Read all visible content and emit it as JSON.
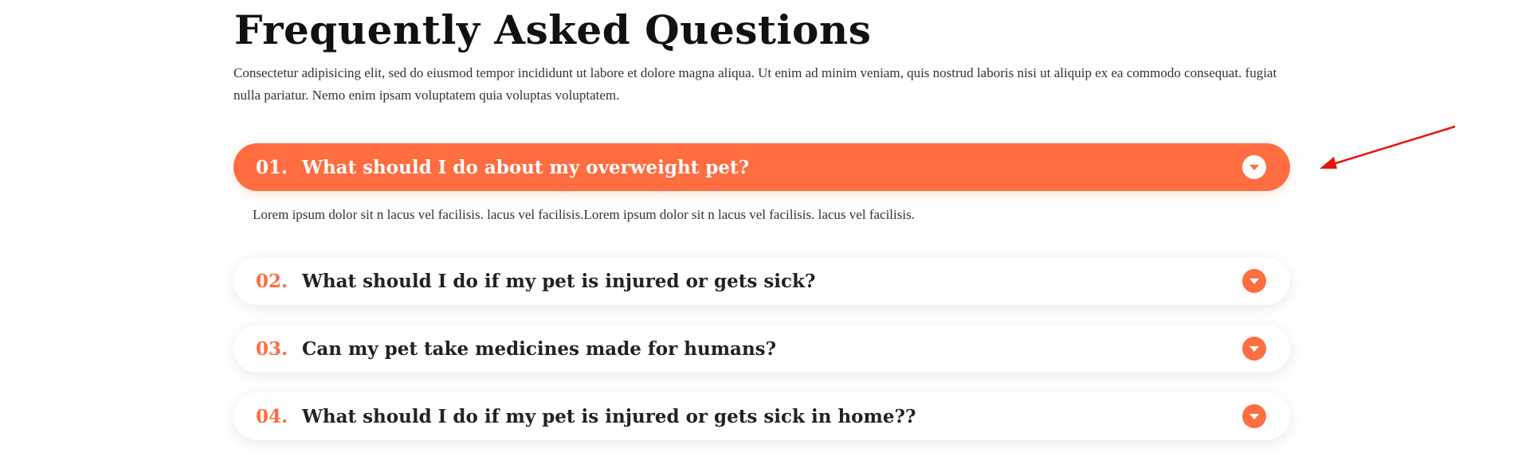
{
  "faq": {
    "title": "Frequently Asked Questions",
    "intro": "Consectetur adipisicing elit, sed do eiusmod tempor incididunt ut labore et dolore magna aliqua. Ut enim ad minim veniam, quis nostrud laboris nisi ut aliquip ex ea commodo consequat. fugiat nulla pariatur. Nemo enim ipsam voluptatem quia voluptas voluptatem.",
    "items": [
      {
        "number": "01.",
        "question": "What should I do about my overweight pet?",
        "expanded": true
      },
      {
        "number": "02.",
        "question": "What should I do if my pet is injured or gets sick?",
        "expanded": false
      },
      {
        "number": "03.",
        "question": "Can my pet take medicines made for humans?",
        "expanded": false
      },
      {
        "number": "04.",
        "question": "What should I do if my pet is injured or gets sick in home??",
        "expanded": false
      }
    ],
    "open_answer": "Lorem ipsum dolor sit n lacus vel facilisis. lacus vel facilisis.Lorem ipsum dolor sit n lacus vel facilisis. lacus vel facilisis.",
    "toggle_icon": "chevron-down-icon"
  },
  "colors": {
    "accent": "#ff6d40",
    "heading": "#111111",
    "body_text": "#333333",
    "annotation_arrow": "#e8140c"
  }
}
